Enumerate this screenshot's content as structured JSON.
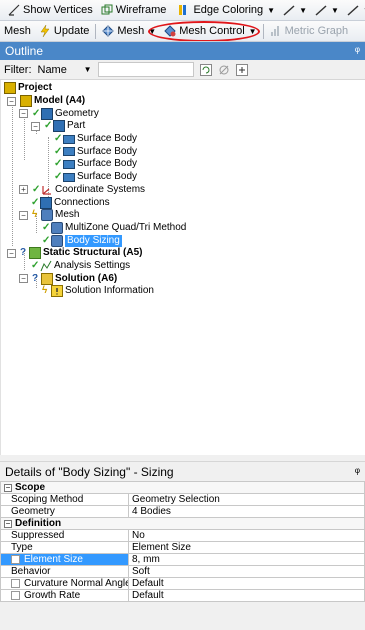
{
  "toolbar1": {
    "show_vertices": "Show Vertices",
    "wireframe": "Wireframe",
    "edge_coloring": "Edge Coloring"
  },
  "toolbar2": {
    "mesh": "Mesh",
    "update": "Update",
    "mesh_menu": "Mesh",
    "mesh_control": "Mesh Control",
    "metric_graph": "Metric Graph"
  },
  "outline": {
    "title": "Outline",
    "pin": "҂",
    "filter_label": "Filter:",
    "filter_value": "Name"
  },
  "tree": {
    "project": "Project",
    "model": "Model (A4)",
    "geometry": "Geometry",
    "part": "Part",
    "surface_body": "Surface Body",
    "coordinate_systems": "Coordinate Systems",
    "connections": "Connections",
    "mesh": "Mesh",
    "multizone": "MultiZone Quad/Tri Method",
    "body_sizing": "Body Sizing",
    "static_structural": "Static Structural (A5)",
    "analysis_settings": "Analysis Settings",
    "solution": "Solution (A6)",
    "solution_information": "Solution Information"
  },
  "details": {
    "title": "Details of \"Body Sizing\" - Sizing",
    "scope": "Scope",
    "scoping_method_k": "Scoping Method",
    "scoping_method_v": "Geometry Selection",
    "geometry_k": "Geometry",
    "geometry_v": "4 Bodies",
    "definition": "Definition",
    "suppressed_k": "Suppressed",
    "suppressed_v": "No",
    "type_k": "Type",
    "type_v": "Element Size",
    "element_size_k": "Element Size",
    "element_size_v": "8, mm",
    "behavior_k": "Behavior",
    "behavior_v": "Soft",
    "curvature_k": "Curvature Normal Angle",
    "curvature_v": "Default",
    "growth_k": "Growth Rate",
    "growth_v": "Default"
  },
  "colors": {
    "outline_header": "#4a87c8",
    "selection": "#3399ff",
    "annotation_circle": "#e0161a"
  }
}
